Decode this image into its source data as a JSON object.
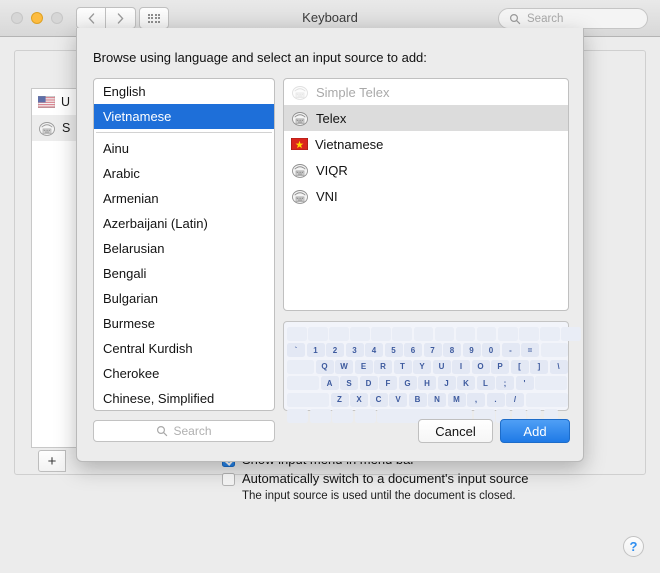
{
  "window": {
    "title": "Keyboard",
    "search_placeholder": "Search",
    "nav_back": "‹",
    "nav_forward": "›",
    "grid_icon": "grid-icon",
    "help_label": "?"
  },
  "background": {
    "input_sources": [
      {
        "label": "U",
        "icon": "us-flag-icon"
      },
      {
        "label": "S",
        "icon": "input-method-icon"
      }
    ],
    "add_button": "+",
    "options": [
      {
        "label": "Show input menu in menu bar",
        "checked": true
      },
      {
        "label": "Automatically switch to a document's input source",
        "checked": false
      }
    ],
    "option_note": "The input source is used until the document is closed."
  },
  "sheet": {
    "title": "Browse using language and select an input source to add:",
    "languages": [
      {
        "label": "English",
        "selected": false
      },
      {
        "label": "Vietnamese",
        "selected": true
      },
      {
        "separator": true
      },
      {
        "label": "Ainu",
        "selected": false
      },
      {
        "label": "Arabic",
        "selected": false
      },
      {
        "label": "Armenian",
        "selected": false
      },
      {
        "label": "Azerbaijani (Latin)",
        "selected": false
      },
      {
        "label": "Belarusian",
        "selected": false
      },
      {
        "label": "Bengali",
        "selected": false
      },
      {
        "label": "Bulgarian",
        "selected": false
      },
      {
        "label": "Burmese",
        "selected": false
      },
      {
        "label": "Central Kurdish",
        "selected": false
      },
      {
        "label": "Cherokee",
        "selected": false
      },
      {
        "label": "Chinese, Simplified",
        "selected": false
      }
    ],
    "input_sources": [
      {
        "label": "Simple Telex",
        "icon": "input-method-icon",
        "state": "disabled"
      },
      {
        "label": "Telex",
        "icon": "input-method-icon",
        "state": "selected"
      },
      {
        "label": "Vietnamese",
        "icon": "vn-flag-icon",
        "state": "normal"
      },
      {
        "label": "VIQR",
        "icon": "input-method-icon",
        "state": "normal"
      },
      {
        "label": "VNI",
        "icon": "input-method-icon",
        "state": "normal"
      }
    ],
    "keyboard_preview": {
      "rows": [
        [
          "",
          "",
          "",
          "",
          "",
          "",
          "",
          "",
          "",
          "",
          "",
          "",
          "",
          ""
        ],
        [
          "`",
          "1",
          "2",
          "3",
          "4",
          "5",
          "6",
          "7",
          "8",
          "9",
          "0",
          "-",
          "=",
          ""
        ],
        [
          "",
          "Q",
          "W",
          "E",
          "R",
          "T",
          "Y",
          "U",
          "I",
          "O",
          "P",
          "[",
          "]",
          "\\"
        ],
        [
          "",
          "A",
          "S",
          "D",
          "F",
          "G",
          "H",
          "J",
          "K",
          "L",
          ";",
          "'",
          ""
        ],
        [
          "",
          "Z",
          "X",
          "C",
          "V",
          "B",
          "N",
          "M",
          ",",
          ".",
          "/",
          ""
        ],
        [
          "",
          "",
          "",
          "",
          "",
          "",
          "",
          ""
        ]
      ]
    },
    "search_placeholder": "Search",
    "cancel_label": "Cancel",
    "add_label": "Add"
  }
}
